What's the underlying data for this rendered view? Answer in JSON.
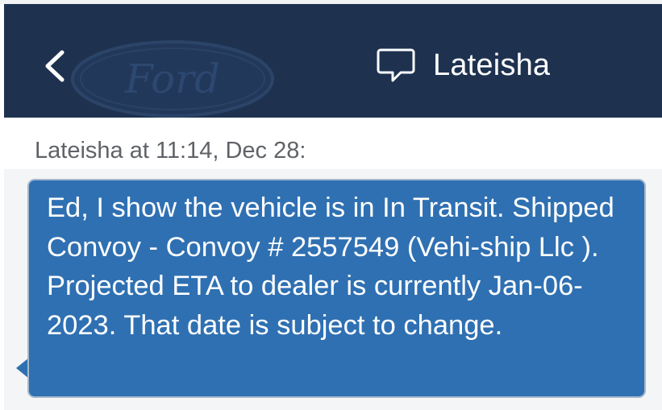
{
  "header": {
    "back_icon": "chevron-left-icon",
    "logo": "Ford",
    "chat_icon": "speech-bubble-icon",
    "contact_name": "Lateisha"
  },
  "message": {
    "sender_line": "Lateisha at 11:14, Dec 28:",
    "text": "Ed, I show the vehicle is in In Transit. Shipped Convoy - Convoy # 2557549 (Vehi-ship Llc ). Projected ETA to dealer is currently Jan-06-2023. That date is subject to change."
  },
  "colors": {
    "header_bg": "#1e3250",
    "bubble_bg": "#2f70b2",
    "bubble_border": "#a6b8cc",
    "sender_text": "#5f6368"
  }
}
